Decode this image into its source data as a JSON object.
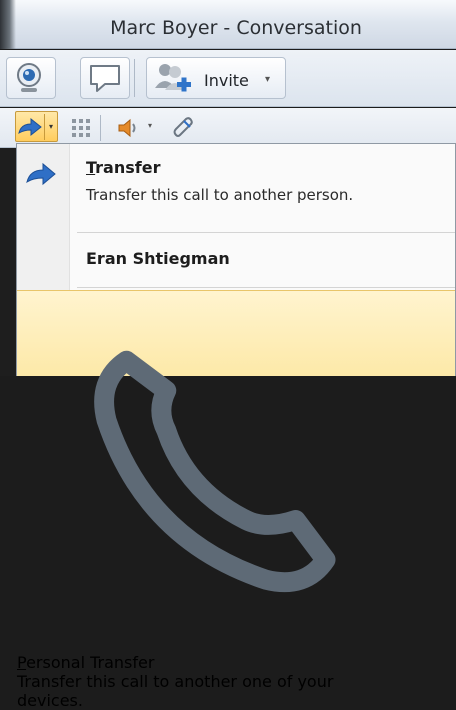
{
  "window": {
    "title": "Marc Boyer - Conversation"
  },
  "toolbar": {
    "video_icon": "webcam-icon",
    "im_icon": "speech-bubble-icon",
    "invite_icon": "add-people-icon",
    "invite_label": "Invite",
    "invite_caret": "▾"
  },
  "call_toolbar": {
    "transfer_icon": "arrow-right-icon",
    "transfer_caret": "▾",
    "dialpad_icon": "dialpad-icon",
    "volume_icon": "speaker-icon",
    "volume_caret": "▾",
    "device_icon": "handset-icon"
  },
  "menu": {
    "items": [
      {
        "key_letter": "T",
        "label_rest": "ransfer",
        "description": "Transfer this call to another person.",
        "icon": "arrow-right-icon"
      },
      {
        "label": "Eran Shtiegman"
      },
      {
        "key_letter": "P",
        "label_rest": "ersonal Transfer",
        "description_line1": "Transfer this call to another one of your",
        "description_line2": "devices.",
        "icon": "phone-icon",
        "highlighted": true
      }
    ]
  },
  "colors": {
    "highlight": "#fde9a8",
    "accent_blue": "#2f6fc6"
  }
}
